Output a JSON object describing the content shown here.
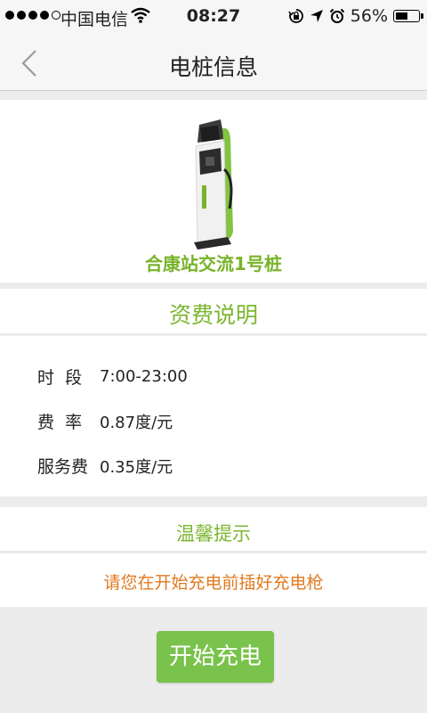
{
  "status_bar": {
    "carrier": "中国电信",
    "time": "08:27",
    "battery": "56%",
    "battery_level": 0.56,
    "icons": [
      "signal-dots-icon",
      "wifi-icon",
      "rotation-lock-icon",
      "location-arrow-icon",
      "alarm-icon",
      "battery-icon"
    ]
  },
  "nav": {
    "title": "电桩信息",
    "back_icon": "chevron-left-icon"
  },
  "station": {
    "name": "合康站交流1号桩",
    "image_icon": "charging-pile-icon"
  },
  "fee": {
    "title": "资费说明",
    "rows": [
      {
        "label": "时  段",
        "value": "7:00-23:00"
      },
      {
        "label": "费  率",
        "value": "0.87度/元"
      },
      {
        "label": "服务费",
        "value": "0.35度/元"
      }
    ]
  },
  "tips": {
    "title": "温馨提示",
    "text": "请您在开始充电前插好充电枪"
  },
  "action": {
    "start_label": "开始充电"
  },
  "colors": {
    "accent_green": "#78b32a",
    "button_green": "#79c24b",
    "tip_orange": "#e07a20"
  }
}
